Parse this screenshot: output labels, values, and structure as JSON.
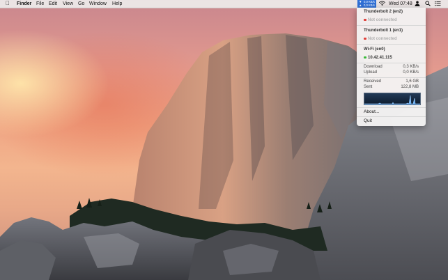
{
  "menubar": {
    "apple_icon": "apple-icon",
    "app_name": "Finder",
    "menus": [
      "File",
      "Edit",
      "View",
      "Go",
      "Window",
      "Help"
    ],
    "net_status": {
      "download": "0,0 KB/s",
      "upload": "0,0 KB/s",
      "accent": "#2f6fd6"
    },
    "clock": "Wed 07:48",
    "icons": [
      "wifi-icon",
      "user-icon",
      "search-icon",
      "list-icon"
    ]
  },
  "dropdown": {
    "interfaces": [
      {
        "name": "Thunderbolt 2 (en2)",
        "status": "Not connected",
        "status_color": "#e0403a"
      },
      {
        "name": "Thunderbolt 1 (en1)",
        "status": "Not connected",
        "status_color": "#e0403a"
      },
      {
        "name": "Wi-Fi (en0)",
        "status": "10.42.41.115",
        "status_color": "#3cba3c"
      }
    ],
    "rates": [
      {
        "label": "Download",
        "value": "0,3 KB/s"
      },
      {
        "label": "Upload",
        "value": "0,0 KB/s"
      }
    ],
    "totals": [
      {
        "label": "Received",
        "value": "1,6 GB"
      },
      {
        "label": "Sent",
        "value": "122,8 MB"
      }
    ],
    "about_label": "About...",
    "quit_label": "Quit"
  }
}
